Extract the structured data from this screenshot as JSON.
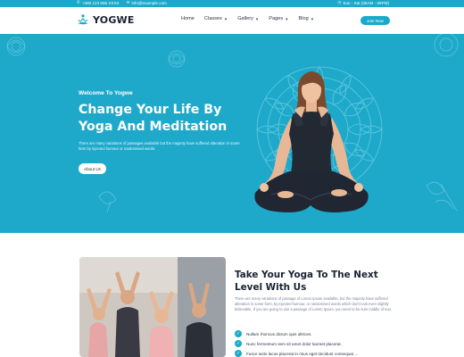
{
  "topbar": {
    "phone": "+380 123 656 XXXX",
    "email": "info@example.com",
    "hours": "Sun - Sat (06AM - 09PM)"
  },
  "brand": {
    "name": "YOGWE"
  },
  "nav": {
    "items": [
      {
        "label": "Home",
        "dropdown": false
      },
      {
        "label": "Classes",
        "dropdown": true
      },
      {
        "label": "Gallery",
        "dropdown": true
      },
      {
        "label": "Pages",
        "dropdown": true
      },
      {
        "label": "Blog",
        "dropdown": true
      }
    ],
    "cta": "Join Now"
  },
  "hero": {
    "eyebrow": "Welcome To Yogwe",
    "title_line1": "Change Your Life By",
    "title_line2": "Yoga And Meditation",
    "description": "There are many variations of passages available but the majority have suffered alteration in some form by injected humour or randomised words.",
    "button": "About Us",
    "background_color": "#1ea9cb"
  },
  "about": {
    "title_line1": "Take Your Yoga To The Next",
    "title_line2": "Level With Us",
    "description": "There are many variations of passage of Lorem Ipsum available, but the majority have suffered alteration in some form, by injected humour, or randomised words which don't look even slightly believable. If you are going to use a passage of Lorem Ipsum, you need to be sure middle of text.",
    "checks": [
      "Nullam rhoncus dictum quis ultrices.",
      "Nunc fermentum sem sit amet dolor laoreet placerat.",
      "Fusce iusto lacus placerat in risus eget tincidunt consequat ..."
    ]
  },
  "colors": {
    "accent": "#19aacb",
    "dark_text": "#1a2233"
  },
  "icons": [
    "phone-icon",
    "mail-icon",
    "clock-icon",
    "lotus-logo-icon",
    "check-icon"
  ]
}
